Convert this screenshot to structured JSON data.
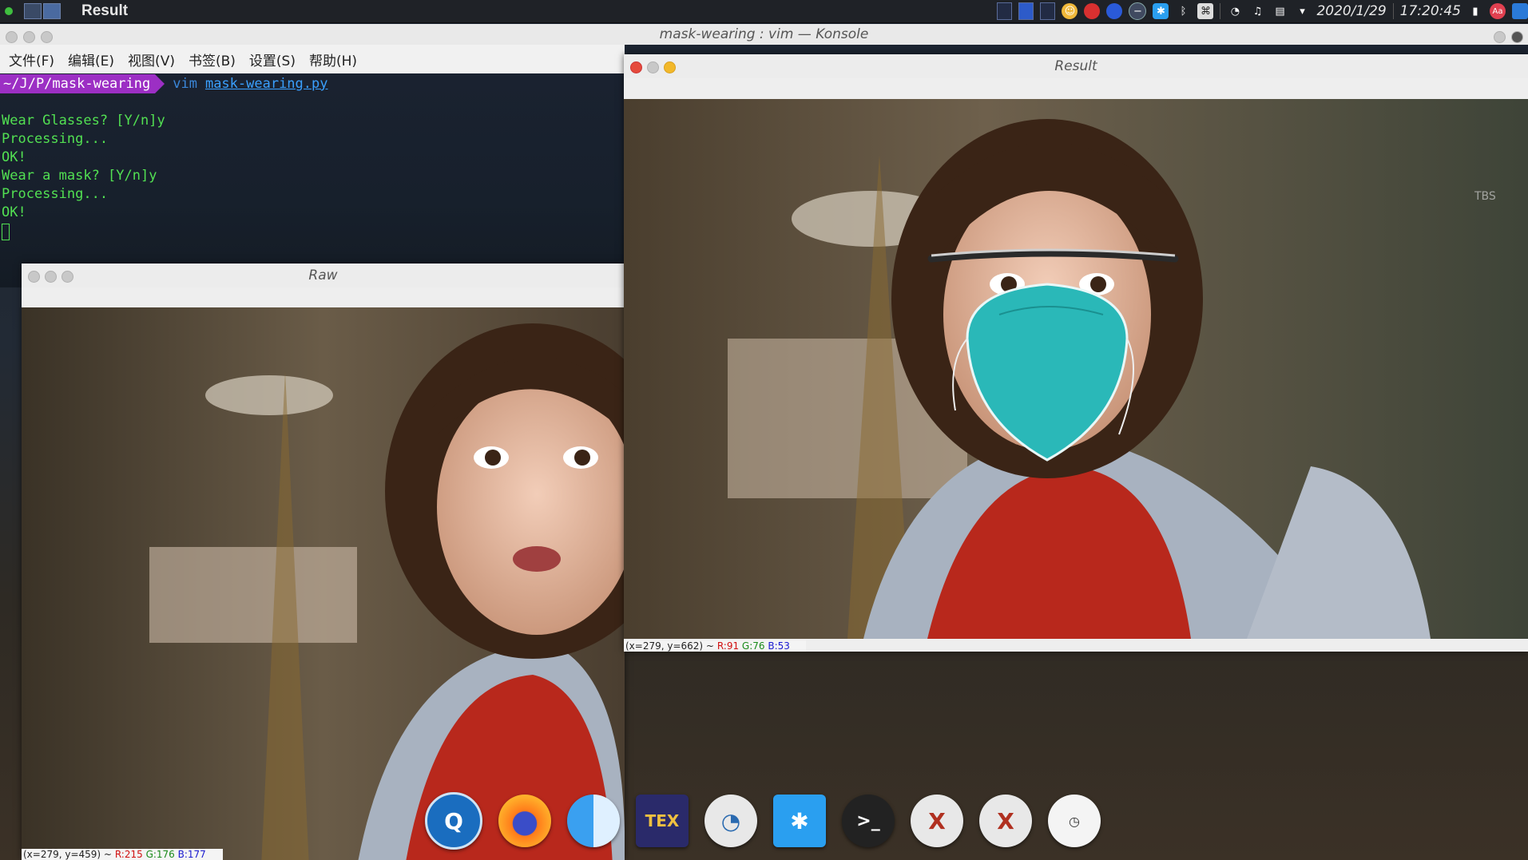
{
  "topbar": {
    "active_app": "Result",
    "date": "2020/1/29",
    "time": "17:20:45",
    "tray_icons": [
      "virtual-desktop-1",
      "virtual-desktop-2",
      "virtual-desktop-3",
      "weather-icon",
      "chrome-icon",
      "pin-icon",
      "dash-icon",
      "star-icon",
      "bluetooth-icon",
      "command-icon",
      "wifi-icon",
      "volume-icon",
      "clipboard-icon",
      "dropdown-icon",
      "trash-icon",
      "input-method-icon",
      "screen-icon"
    ]
  },
  "konsole": {
    "title": "mask-wearing : vim — Konsole",
    "menu": [
      "文件(F)",
      "编辑(E)",
      "视图(V)",
      "书签(B)",
      "设置(S)",
      "帮助(H)"
    ],
    "prompt_path": "~/J/P/mask-wearing",
    "command": "vim",
    "command_arg": "mask-wearing.py",
    "output": [
      "Wear Glasses? [Y/n]y",
      "Processing...",
      "OK!",
      "Wear a mask? [Y/n]y",
      "Processing...",
      "OK!"
    ]
  },
  "raw_window": {
    "title": "Raw",
    "status_prefix": "(x=279, y=459) ~",
    "r": "R:215",
    "g": "G:176",
    "b": "B:177"
  },
  "result_window": {
    "title": "Result",
    "status_prefix": "(x=279, y=662) ~",
    "r": "R:91",
    "g": "G:76",
    "b": "B:53",
    "watermark": "TBS"
  },
  "dock": {
    "items": [
      {
        "name": "qt-creator-icon",
        "glyph": "Q",
        "color": "#1a6dbf"
      },
      {
        "name": "firefox-icon",
        "glyph": "",
        "color": "#ff7a1a"
      },
      {
        "name": "finder-icon",
        "glyph": "",
        "color": "#3aa0f0"
      },
      {
        "name": "texstudio-icon",
        "glyph": "TEX",
        "color": "#2a2a6a"
      },
      {
        "name": "preview-icon",
        "glyph": "",
        "color": "#e8e8e8"
      },
      {
        "name": "kde-connect-icon",
        "glyph": "✱",
        "color": "#2a9ff0"
      },
      {
        "name": "terminal-icon",
        "glyph": ">_",
        "color": "#222222"
      },
      {
        "name": "x11-icon",
        "glyph": "X",
        "color": "#e8e8e8"
      },
      {
        "name": "x11-icon-2",
        "glyph": "X",
        "color": "#e8e8e8"
      },
      {
        "name": "clock-icon",
        "glyph": "",
        "color": "#f4f4f4"
      }
    ]
  }
}
